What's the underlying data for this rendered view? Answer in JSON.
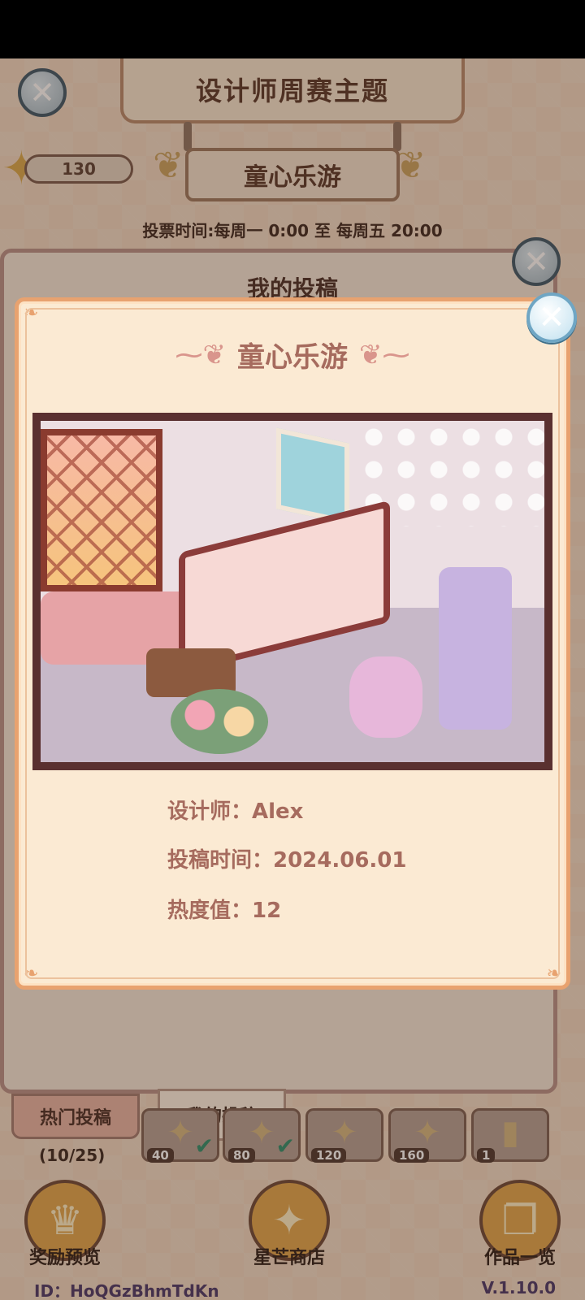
{
  "header": {
    "title": "设计师周赛主题",
    "theme_name": "童心乐游",
    "star_count": "130",
    "vote_time": "投票时间:每周一  0:00  至  每周五  20:00"
  },
  "panel": {
    "title": "我的投稿",
    "tabs": [
      {
        "label": "热门投稿"
      },
      {
        "label": "我的投稿"
      }
    ],
    "progress": "(10/25)",
    "reward_slots": [
      {
        "value": "40",
        "claimed": true
      },
      {
        "value": "80",
        "claimed": true
      },
      {
        "value": "120",
        "claimed": false
      },
      {
        "value": "160",
        "claimed": false
      },
      {
        "value": "1",
        "claimed": false
      }
    ]
  },
  "bottom_nav": {
    "reward_preview": "奖励预览",
    "star_shop": "星芒商店",
    "works_list": "作品一览"
  },
  "footer": {
    "id": "ID：HoQGzBhmTdKn",
    "version": "V.1.10.0"
  },
  "dialog": {
    "title": "童心乐游",
    "designer": "设计师：Alex",
    "submit_time": "投稿时间：2024.06.01",
    "popularity": "热度值：12"
  },
  "colors": {
    "dialog_border": "#e8a26f",
    "dialog_bg": "#fbead3",
    "accent_text": "#a66b5e"
  }
}
